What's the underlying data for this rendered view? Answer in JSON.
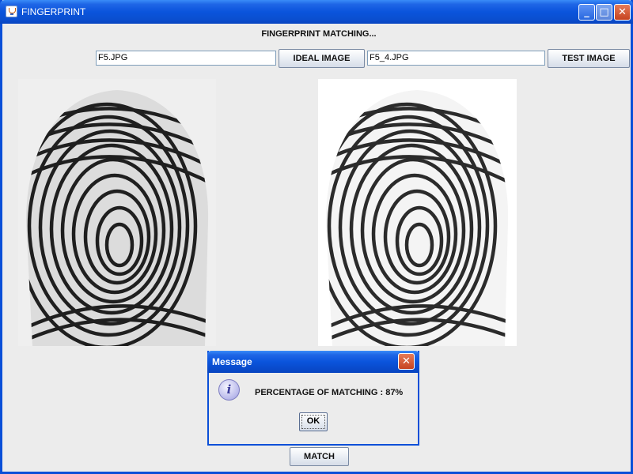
{
  "window": {
    "title": "FINGERPRINT",
    "minimize_glyph": "_",
    "maximize_glyph": "□",
    "close_glyph": "✕"
  },
  "main": {
    "heading": "FINGERPRINT MATCHING...",
    "ideal_field_value": "F5.JPG",
    "ideal_button_label": "IDEAL IMAGE",
    "test_field_value": "F5_4.JPG",
    "test_button_label": "TEST IMAGE",
    "match_button_label": "MATCH"
  },
  "dialog": {
    "title": "Message",
    "icon": "info-icon",
    "icon_glyph": "i",
    "message": "PERCENTAGE OF MATCHING : 87%",
    "ok_label": "OK",
    "close_glyph": "✕"
  },
  "colors": {
    "titlebar": "#0a54dc",
    "window_bg": "#ececec",
    "close_button": "#c64320"
  }
}
